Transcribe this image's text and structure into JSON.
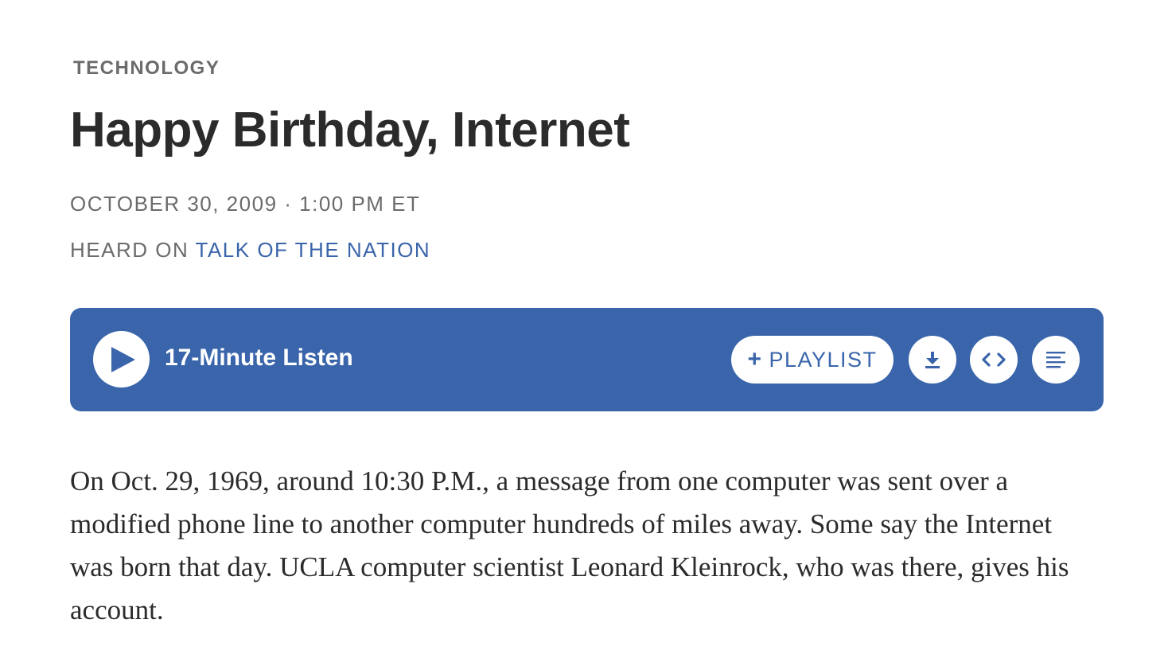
{
  "article": {
    "section": "TECHNOLOGY",
    "title": "Happy Birthday, Internet",
    "dateline": "OCTOBER 30, 2009 · 1:00 PM ET",
    "heard_on_prefix": "HEARD ON ",
    "program": "TALK OF THE NATION",
    "teaser": "On Oct. 29, 1969, around 10:30 P.M., a message from one computer was sent over a modified phone line to another computer hundreds of miles away. Some say the Internet was born that day. UCLA computer scientist Leonard Kleinrock, who was there, gives his account."
  },
  "player": {
    "listen_label": "17-Minute Listen",
    "playlist_plus": "+",
    "playlist_label": "PLAYLIST",
    "icons": {
      "play": "play-icon",
      "download": "download-icon",
      "embed": "embed-code-icon",
      "transcript": "transcript-lines-icon"
    },
    "colors": {
      "bar": "#3a65ab",
      "button_bg": "#ffffff",
      "accent": "#3a65ab"
    }
  }
}
